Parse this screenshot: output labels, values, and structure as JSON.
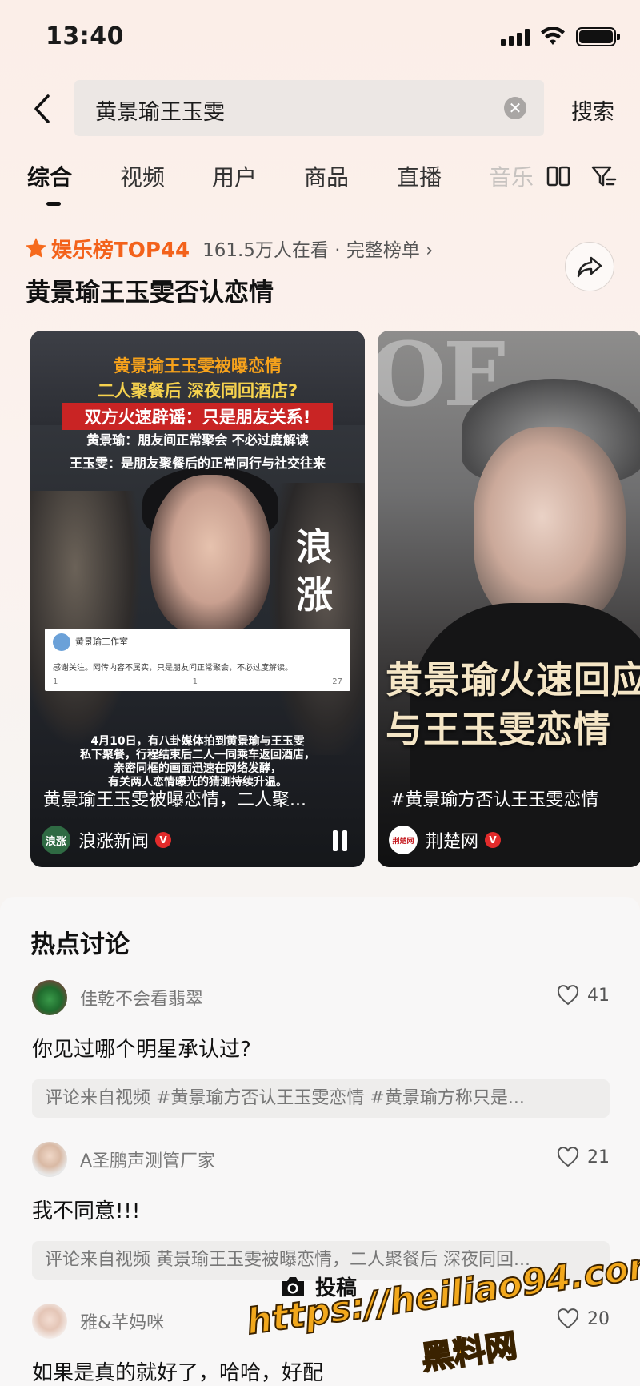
{
  "status_bar": {
    "time": "13:40"
  },
  "search": {
    "query": "黄景瑜王玉雯",
    "submit_label": "搜索"
  },
  "tabs": [
    "综合",
    "视频",
    "用户",
    "商品",
    "直播",
    "音乐"
  ],
  "active_tab": "综合",
  "ranking": {
    "label": "娱乐榜TOP44",
    "meta": "161.5万人在看 · 完整榜单 ›",
    "headline": "黄景瑜王玉雯否认恋情"
  },
  "cards": [
    {
      "overlay_title_1": "黄景瑜王玉雯被曝恋情",
      "overlay_title_2": "二人聚餐后 深夜同回酒店?",
      "overlay_title_3": "双方火速辟谣：只是朋友关系!",
      "overlay_sub_1": "黄景瑜：朋友间正常聚会 不必过度解读",
      "overlay_sub_2": "王玉雯：是朋友聚餐后的正常同行与社交往来",
      "watermark_logo": "浪涨",
      "weibo_user": "黄景瑜工作室",
      "weibo_text": "感谢关注。网传内容不属实，只是朋友间正常聚会，不必过度解读。",
      "weibo_stats": [
        "1",
        "1",
        "27"
      ],
      "caption_lines": [
        "4月10日，有八卦媒体拍到黄景瑜与王玉雯",
        "私下聚餐，行程结束后二人一同乘车返回酒店，",
        "亲密同框的画面迅速在网络发酵，",
        "有关两人恋情曝光的猜测持续升温。"
      ],
      "title": "黄景瑜王玉雯被曝恋情，二人聚...",
      "source": "浪涨新闻",
      "source_logo": "浪涨"
    },
    {
      "overlay_big_1": "黄景瑜火速回应",
      "overlay_big_2": "与王玉雯恋情",
      "title": "#黄景瑜方否认王玉雯恋情",
      "source": "荆楚网",
      "source_logo": "荆楚网"
    }
  ],
  "hot": {
    "title": "热点讨论",
    "posts": [
      {
        "user": "佳乾不会看翡翠",
        "likes": "41",
        "text": "你见过哪个明星承认过?",
        "ref": "评论来自视频 #黄景瑜方否认王玉雯恋情 #黄景瑜方称只是..."
      },
      {
        "user": "A圣鹏声测管厂家",
        "likes": "21",
        "text": "我不同意!!!",
        "ref": "评论来自视频 黄景瑜王玉雯被曝恋情，二人聚餐后 深夜同回..."
      },
      {
        "user": "雅&芊妈咪",
        "likes": "20",
        "text": "如果是真的就好了，哈哈，好配",
        "ref": ""
      }
    ]
  },
  "post_button": "投稿",
  "watermark": {
    "url": "https://heiliao94.com",
    "name": "黑料网"
  }
}
